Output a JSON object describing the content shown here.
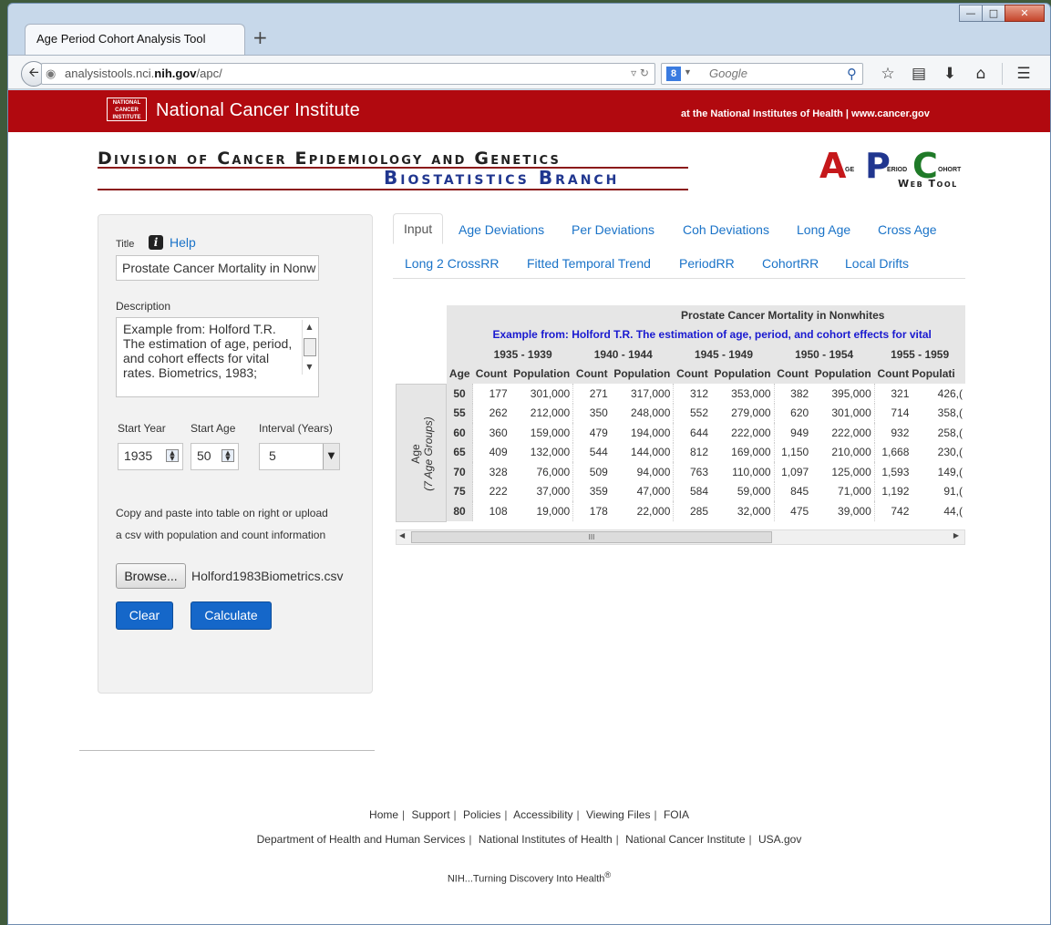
{
  "browser": {
    "tab_title": "Age Period Cohort Analysis Tool",
    "new_tab": "+",
    "url_prefix": "analysistools.nci.",
    "url_domain": "nih.gov",
    "url_path": "/apc/",
    "search_placeholder": "Google"
  },
  "banner": {
    "org_logo_text": "NATIONAL CANCER INSTITUTE",
    "org_name": "National Cancer Institute",
    "right_text": "at the National Institutes of Health | www.cancer.gov"
  },
  "header": {
    "division": "Division of Cancer Epidemiology and Genetics",
    "branch": "Biostatistics Branch",
    "logo_letters": [
      "A",
      "P",
      "C"
    ],
    "logo_words": [
      "GE",
      "ERIOD",
      "OHORT"
    ],
    "logo_web_tool": "Web Tool"
  },
  "form": {
    "title_label": "Title",
    "help_label": "Help",
    "title_value": "Prostate Cancer Mortality in Nonw",
    "description_label": "Description",
    "description_value": "Example from: Holford T.R. The estimation of age, period, and cohort effects for vital rates. Biometrics, 1983;",
    "start_year_label": "Start Year",
    "start_year_value": "1935",
    "start_age_label": "Start Age",
    "start_age_value": "50",
    "interval_label": "Interval (Years)",
    "interval_value": "5",
    "help_text_1": "Copy and paste into table on right or upload",
    "help_text_2": "a csv with population and count information",
    "browse_label": "Browse...",
    "file_name": "Holford1983Biometrics.csv",
    "clear_label": "Clear",
    "calculate_label": "Calculate"
  },
  "tabs": [
    {
      "label": "Input"
    },
    {
      "label": "Age Deviations"
    },
    {
      "label": "Per Deviations"
    },
    {
      "label": "Coh Deviations"
    },
    {
      "label": "Long Age"
    },
    {
      "label": "Cross Age"
    },
    {
      "label": "Long 2 CrossRR"
    },
    {
      "label": "Fitted Temporal Trend"
    },
    {
      "label": "PeriodRR"
    },
    {
      "label": "CohortRR"
    },
    {
      "label": "Local Drifts"
    }
  ],
  "table": {
    "title": "Prostate Cancer Mortality in Nonwhites",
    "subtitle": "Example from: Holford T.R. The estimation of age, period, and cohort effects for vital",
    "side_label_1": "Age",
    "side_label_2": "(7 Age Groups)",
    "age_header": "Age",
    "count_header": "Count",
    "population_header": "Population",
    "population_header_cut": "Populati",
    "periods": [
      "1935 - 1939",
      "1940 - 1944",
      "1945 - 1949",
      "1950 - 1954",
      "1955 - 1959"
    ],
    "rows": [
      {
        "age": "50",
        "cells": [
          "177",
          "301,000",
          "271",
          "317,000",
          "312",
          "353,000",
          "382",
          "395,000",
          "321",
          "426,("
        ]
      },
      {
        "age": "55",
        "cells": [
          "262",
          "212,000",
          "350",
          "248,000",
          "552",
          "279,000",
          "620",
          "301,000",
          "714",
          "358,("
        ]
      },
      {
        "age": "60",
        "cells": [
          "360",
          "159,000",
          "479",
          "194,000",
          "644",
          "222,000",
          "949",
          "222,000",
          "932",
          "258,("
        ]
      },
      {
        "age": "65",
        "cells": [
          "409",
          "132,000",
          "544",
          "144,000",
          "812",
          "169,000",
          "1,150",
          "210,000",
          "1,668",
          "230,("
        ]
      },
      {
        "age": "70",
        "cells": [
          "328",
          "76,000",
          "509",
          "94,000",
          "763",
          "110,000",
          "1,097",
          "125,000",
          "1,593",
          "149,("
        ]
      },
      {
        "age": "75",
        "cells": [
          "222",
          "37,000",
          "359",
          "47,000",
          "584",
          "59,000",
          "845",
          "71,000",
          "1,192",
          "91,("
        ]
      },
      {
        "age": "80",
        "cells": [
          "108",
          "19,000",
          "178",
          "22,000",
          "285",
          "32,000",
          "475",
          "39,000",
          "742",
          "44,("
        ]
      }
    ],
    "scroll_thumb": "III"
  },
  "footer": {
    "links_1": [
      "Home",
      "Support",
      "Policies",
      "Accessibility",
      "Viewing Files",
      "FOIA"
    ],
    "links_2": [
      "Department of Health and Human Services",
      "National Institutes of Health",
      "National Cancer Institute",
      "USA.gov"
    ],
    "tagline": "NIH...Turning Discovery Into Health",
    "tagline_mark": "®"
  }
}
